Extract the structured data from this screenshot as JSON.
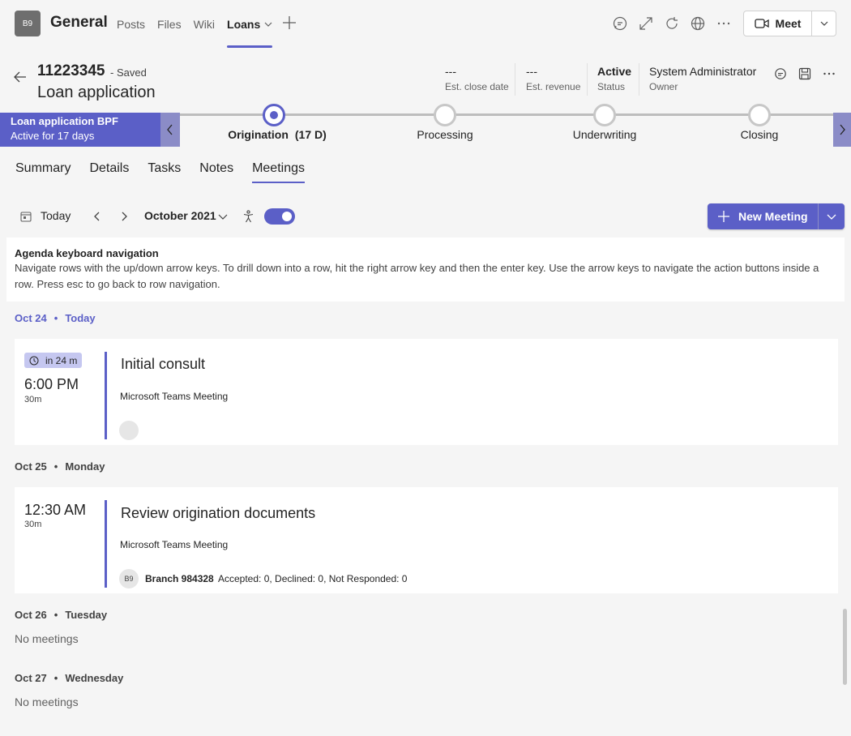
{
  "app": {
    "team_initials": "B9",
    "team_name": "General",
    "tabs": [
      {
        "label": "Posts"
      },
      {
        "label": "Files"
      },
      {
        "label": "Wiki"
      },
      {
        "label": "Loans"
      }
    ],
    "meet_label": "Meet"
  },
  "record": {
    "id": "11223345",
    "saved": "- Saved",
    "title": "Loan application",
    "fields": [
      {
        "value": "---",
        "label": "Est. close date"
      },
      {
        "value": "---",
        "label": "Est. revenue"
      },
      {
        "value": "Active",
        "label": "Status"
      },
      {
        "value": "System Administrator",
        "label": "Owner"
      }
    ]
  },
  "bpf": {
    "name": "Loan application BPF",
    "status": "Active for 17 days",
    "stages": [
      {
        "label": "Origination",
        "days": "(17 D)"
      },
      {
        "label": "Processing"
      },
      {
        "label": "Underwriting"
      },
      {
        "label": "Closing"
      }
    ]
  },
  "subtabs": [
    "Summary",
    "Details",
    "Tasks",
    "Notes",
    "Meetings"
  ],
  "calendar": {
    "today_label": "Today",
    "month": "October 2021",
    "new_meeting_label": "New Meeting"
  },
  "info": {
    "heading": "Agenda keyboard navigation",
    "body": "Navigate rows with the up/down arrow keys. To drill down into a row, hit the right arrow key and then the enter key. Use the arrow keys to navigate the action buttons inside a row. Press esc to go back to row navigation."
  },
  "agenda": {
    "day1": {
      "date": "Oct 24",
      "dot": "•",
      "day": "Today"
    },
    "meeting1": {
      "badge": "in 24 m",
      "time": "6:00 PM",
      "duration": "30m",
      "title": "Initial consult",
      "type": "Microsoft Teams Meeting"
    },
    "day2": {
      "date": "Oct 25",
      "dot": "•",
      "day": "Monday"
    },
    "meeting2": {
      "time": "12:30 AM",
      "duration": "30m",
      "title": "Review origination documents",
      "type": "Microsoft Teams Meeting",
      "attendee_initials": "B9",
      "attendee_name": "Branch 984328",
      "attendee_status": "Accepted: 0, Declined: 0, Not Responded: 0"
    },
    "day3": {
      "date": "Oct 26",
      "dot": "•",
      "day": "Tuesday",
      "empty": "No meetings"
    },
    "day4": {
      "date": "Oct 27",
      "dot": "•",
      "day": "Wednesday",
      "empty": "No meetings"
    }
  },
  "colors": {
    "accent": "#5b5fc7",
    "accent_light": "#8b8cc7",
    "badge": "#c5c7f0",
    "link": "#115ea3"
  },
  "icons": [
    "chevron-down-icon",
    "plus-icon",
    "chat-icon",
    "expand-icon",
    "refresh-icon",
    "globe-icon",
    "more-icon",
    "video-icon",
    "back-arrow-icon",
    "save-icon",
    "calendar-icon",
    "chevron-left-icon",
    "chevron-right-icon",
    "accessibility-icon",
    "clock-icon"
  ]
}
